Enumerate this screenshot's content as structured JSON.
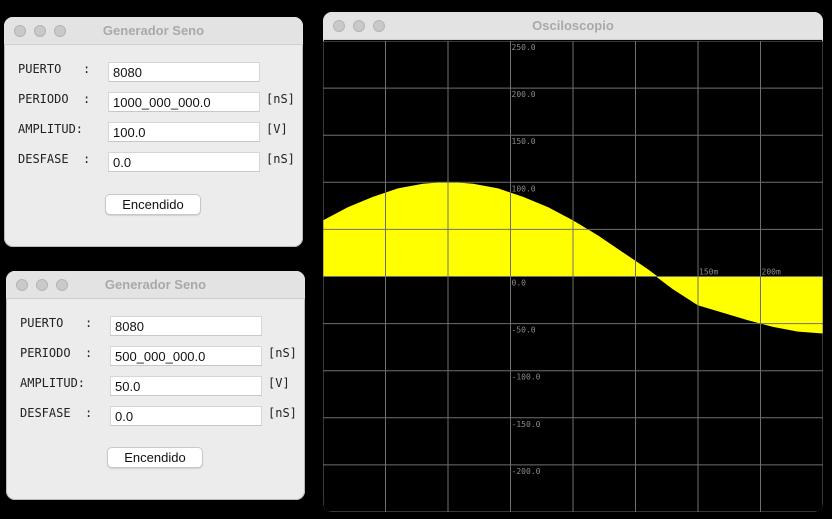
{
  "generators": [
    {
      "title": "Generador Seno",
      "fields": [
        {
          "label": "PUERTO   :",
          "value": "8080",
          "unit": ""
        },
        {
          "label": "PERIODO  :",
          "value": "1000_000_000.0",
          "unit": "[nS]"
        },
        {
          "label": "AMPLITUD:",
          "value": "100.0",
          "unit": "[V]"
        },
        {
          "label": "DESFASE  :",
          "value": "0.0",
          "unit": "[nS]"
        }
      ],
      "button": "Encendido"
    },
    {
      "title": "Generador Seno",
      "fields": [
        {
          "label": "PUERTO   :",
          "value": "8080",
          "unit": ""
        },
        {
          "label": "PERIODO  :",
          "value": "500_000_000.0",
          "unit": "[nS]"
        },
        {
          "label": "AMPLITUD:",
          "value": "50.0",
          "unit": "[V]"
        },
        {
          "label": "DESFASE  :",
          "value": "0.0",
          "unit": "[nS]"
        }
      ],
      "button": "Encendido"
    }
  ],
  "oscilloscope": {
    "title": "Osciloscopio",
    "colors": {
      "background": "#000000",
      "grid": "#6f6f6f",
      "trace": "#ffff00",
      "labels": "#8a8a8a"
    },
    "y_labels": [
      "250.0",
      "200.0",
      "150.0",
      "100.0",
      "0.0",
      "-50.0",
      "-100.0",
      "-150.0",
      "-200.0"
    ],
    "x_labels": [
      "150m",
      "200m"
    ]
  },
  "chart_data": {
    "type": "area",
    "title": "",
    "xlabel": "",
    "ylabel": "",
    "x_units": "ms",
    "xlim": [
      -150,
      250
    ],
    "ylim": [
      -250,
      250
    ],
    "series": [
      {
        "values": [
          [
            -150,
            59
          ],
          [
            -130,
            73
          ],
          [
            -110,
            84
          ],
          [
            -90,
            93
          ],
          [
            -70,
            98
          ],
          [
            -50,
            100
          ],
          [
            -30,
            98
          ],
          [
            -10,
            93
          ],
          [
            10,
            84
          ],
          [
            30,
            73
          ],
          [
            50,
            59
          ],
          [
            70,
            43
          ],
          [
            90,
            25
          ],
          [
            110,
            7
          ],
          [
            130,
            -13
          ],
          [
            150,
            -30
          ],
          [
            170,
            -38
          ],
          [
            190,
            -46
          ],
          [
            210,
            -53
          ],
          [
            230,
            -58
          ],
          [
            250,
            -60
          ]
        ]
      }
    ]
  }
}
